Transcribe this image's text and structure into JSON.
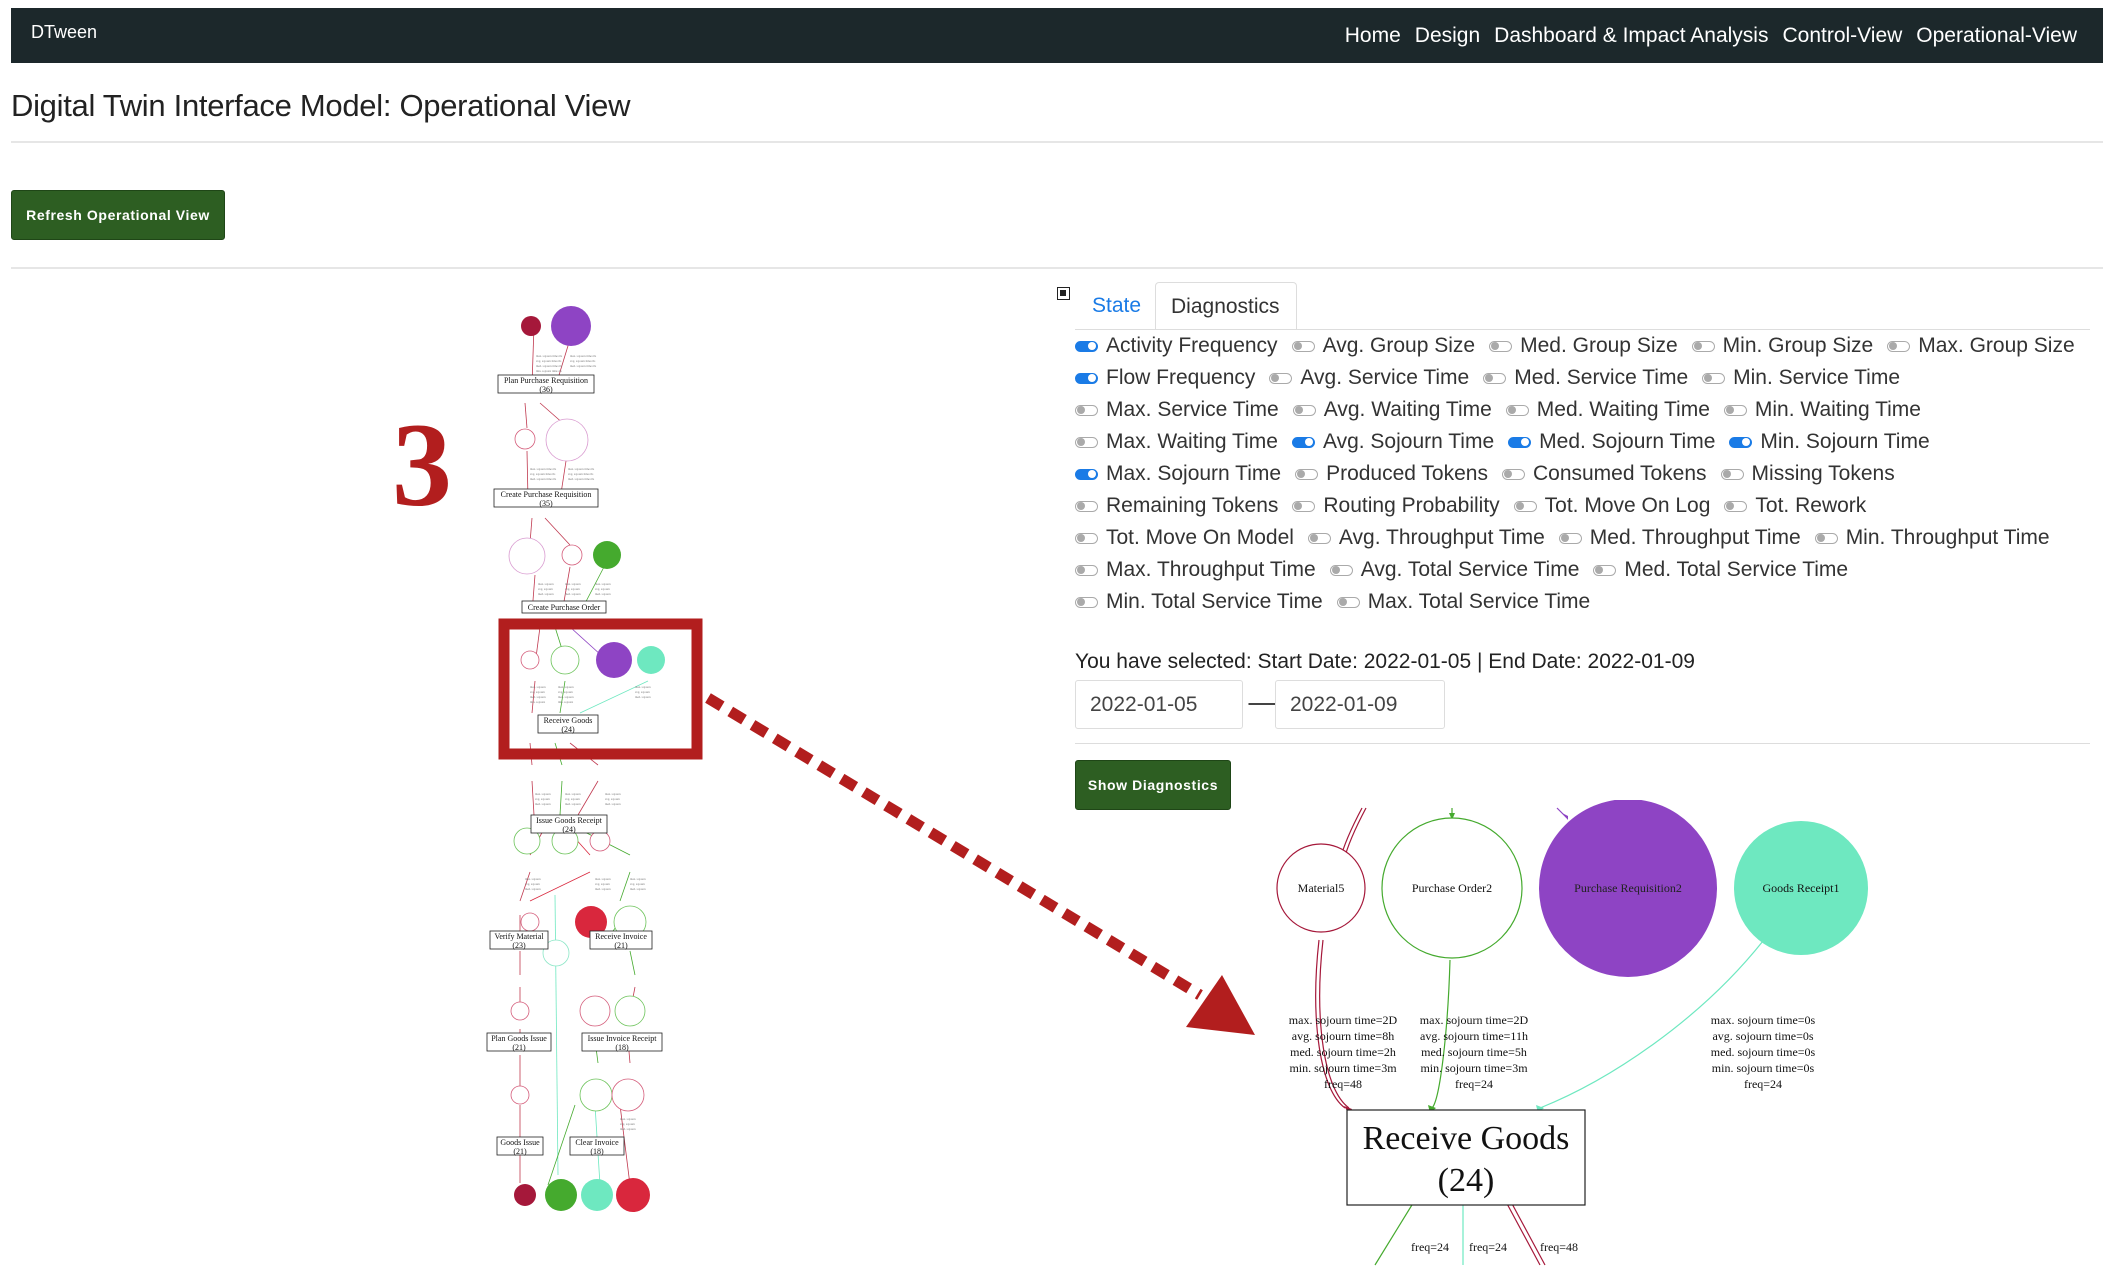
{
  "navbar": {
    "brand": "DTween",
    "links": [
      "Home",
      "Design",
      "Dashboard & Impact Analysis",
      "Control-View",
      "Operational-View"
    ]
  },
  "page_title": "Digital Twin Interface Model: Operational View",
  "refresh_button": "Refresh Operational View",
  "annotation_number": "3",
  "tabs": {
    "state": "State",
    "diagnostics": "Diagnostics"
  },
  "options": [
    [
      {
        "label": "Activity Frequency",
        "on": true
      },
      {
        "label": "Avg. Group Size",
        "on": false
      },
      {
        "label": "Med. Group Size",
        "on": false
      },
      {
        "label": "Min. Group Size",
        "on": false
      },
      {
        "label": "Max. Group Size",
        "on": false
      }
    ],
    [
      {
        "label": "Flow Frequency",
        "on": true
      },
      {
        "label": "Avg. Service Time",
        "on": false
      },
      {
        "label": "Med. Service Time",
        "on": false
      },
      {
        "label": "Min. Service Time",
        "on": false
      }
    ],
    [
      {
        "label": "Max. Service Time",
        "on": false
      },
      {
        "label": "Avg. Waiting Time",
        "on": false
      },
      {
        "label": "Med. Waiting Time",
        "on": false
      },
      {
        "label": "Min. Waiting Time",
        "on": false
      }
    ],
    [
      {
        "label": "Max. Waiting Time",
        "on": false
      },
      {
        "label": "Avg. Sojourn Time",
        "on": true
      },
      {
        "label": "Med. Sojourn Time",
        "on": true
      },
      {
        "label": "Min. Sojourn Time",
        "on": true
      }
    ],
    [
      {
        "label": "Max. Sojourn Time",
        "on": true
      },
      {
        "label": "Produced Tokens",
        "on": false
      },
      {
        "label": "Consumed Tokens",
        "on": false
      },
      {
        "label": "Missing Tokens",
        "on": false
      }
    ],
    [
      {
        "label": "Remaining Tokens",
        "on": false
      },
      {
        "label": "Routing Probability",
        "on": false
      },
      {
        "label": "Tot. Move On Log",
        "on": false
      },
      {
        "label": "Tot. Rework",
        "on": false
      }
    ],
    [
      {
        "label": "Tot. Move On Model",
        "on": false
      },
      {
        "label": "Avg. Throughput Time",
        "on": false
      },
      {
        "label": "Med. Throughput Time",
        "on": false
      },
      {
        "label": "Min. Throughput Time",
        "on": false
      }
    ],
    [
      {
        "label": "Max. Throughput Time",
        "on": false
      },
      {
        "label": "Avg. Total Service Time",
        "on": false
      },
      {
        "label": "Med. Total Service Time",
        "on": false
      }
    ],
    [
      {
        "label": "Min. Total Service Time",
        "on": false
      },
      {
        "label": "Max. Total Service Time",
        "on": false
      }
    ]
  ],
  "selection_text": "You have selected: Start Date: 2022-01-05 | End Date: 2022-01-09",
  "start_date": "2022-01-05",
  "end_date": "2022-01-09",
  "date_arrow": "⟶",
  "show_button": "Show Diagnostics",
  "small_graph": {
    "activities": [
      {
        "name": "Plan Purchase Requisition",
        "count": "(36)"
      },
      {
        "name": "Create Purchase Requisition",
        "count": "(35)"
      },
      {
        "name": "Create Purchase Order",
        "count": ""
      },
      {
        "name": "Receive Goods",
        "count": "(24)"
      },
      {
        "name": "Issue Goods Receipt",
        "count": "(24)"
      },
      {
        "name": "Verify Material",
        "count": "(23)"
      },
      {
        "name": "Receive Invoice",
        "count": "(21)"
      },
      {
        "name": "Plan Goods Issue",
        "count": "(21)"
      },
      {
        "name": "Issue Invoice Receipt",
        "count": "(18)"
      },
      {
        "name": "Goods Issue",
        "count": "(21)"
      },
      {
        "name": "Clear Invoice",
        "count": "(18)"
      }
    ]
  },
  "zoom": {
    "places": [
      "Material5",
      "Purchase Order2",
      "Purchase Requisition2",
      "Goods Receipt1"
    ],
    "stats": [
      [
        "max. sojourn time=2D",
        "avg. sojourn time=8h",
        "med. sojourn time=2h",
        "min. sojourn time=3m",
        "freq=48"
      ],
      [
        "max. sojourn time=2D",
        "avg. sojourn time=11h",
        "med. sojourn time=5h",
        "min. sojourn time=3m",
        "freq=24"
      ],
      [
        "max. sojourn time=0s",
        "avg. sojourn time=0s",
        "med. sojourn time=0s",
        "min. sojourn time=0s",
        "freq=24"
      ]
    ],
    "activity_name": "Receive Goods",
    "activity_count": "(24)",
    "out_freqs": [
      "freq=24",
      "freq=24",
      "freq=48"
    ]
  },
  "colors": {
    "navbar": "#1c282b",
    "button_green": "#2d5e22",
    "accent_blue": "#1a7be6",
    "highlight_red": "#b21e1e",
    "place_purple": "#8e44c4",
    "place_mint": "#6ee8c0",
    "place_green": "#45aa2e",
    "place_red": "#d9273d",
    "place_darkred": "#a5183a"
  }
}
